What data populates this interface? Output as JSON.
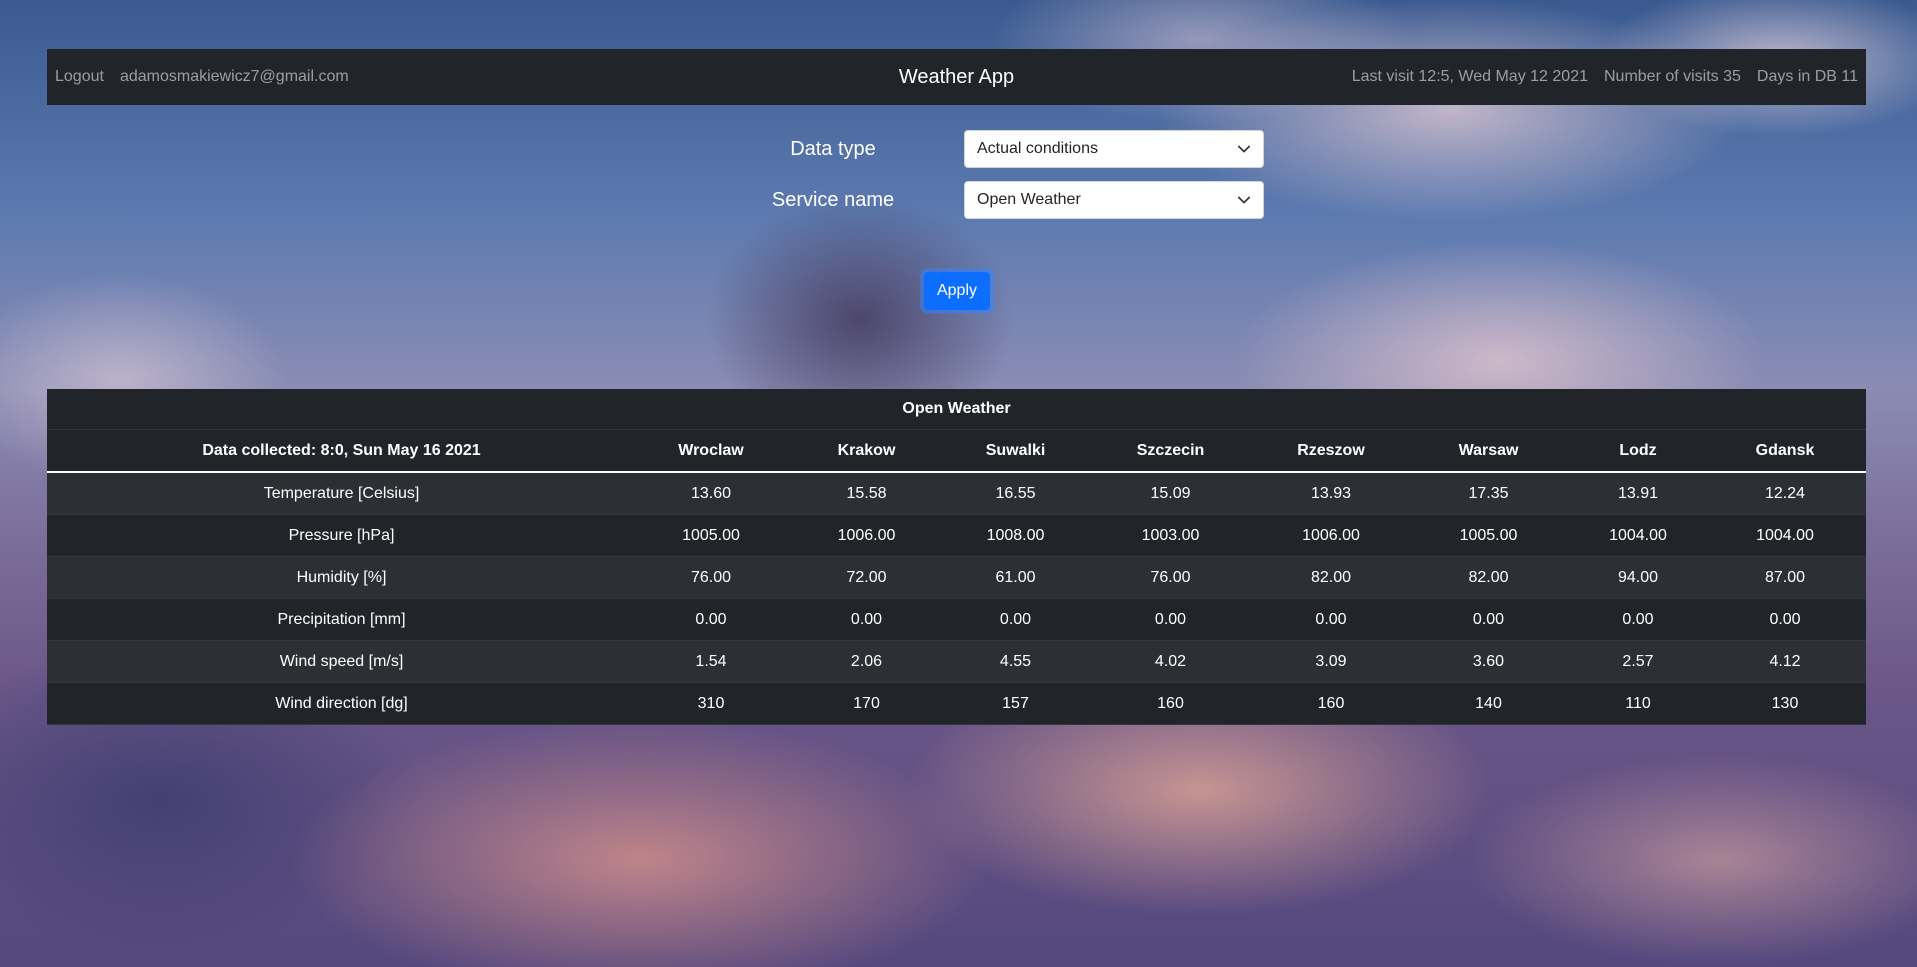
{
  "navbar": {
    "logout_label": "Logout",
    "user_email": "adamosmakiewicz7@gmail.com",
    "brand": "Weather App",
    "last_visit": "Last visit 12:5, Wed May 12 2021",
    "visits": "Number of visits 35",
    "days_in_db": "Days in DB 11"
  },
  "form": {
    "data_type_label": "Data type",
    "data_type_value": "Actual conditions",
    "service_name_label": "Service name",
    "service_name_value": "Open Weather",
    "apply_label": "Apply"
  },
  "table": {
    "caption": "Open Weather",
    "collected_header": "Data collected: 8:0, Sun May 16 2021",
    "cities": [
      "Wroclaw",
      "Krakow",
      "Suwalki",
      "Szczecin",
      "Rzeszow",
      "Warsaw",
      "Lodz",
      "Gdansk"
    ],
    "rows": [
      {
        "label": "Temperature [Celsius]",
        "values": [
          "13.60",
          "15.58",
          "16.55",
          "15.09",
          "13.93",
          "17.35",
          "13.91",
          "12.24"
        ]
      },
      {
        "label": "Pressure [hPa]",
        "values": [
          "1005.00",
          "1006.00",
          "1008.00",
          "1003.00",
          "1006.00",
          "1005.00",
          "1004.00",
          "1004.00"
        ]
      },
      {
        "label": "Humidity [%]",
        "values": [
          "76.00",
          "72.00",
          "61.00",
          "76.00",
          "82.00",
          "82.00",
          "94.00",
          "87.00"
        ]
      },
      {
        "label": "Precipitation [mm]",
        "values": [
          "0.00",
          "0.00",
          "0.00",
          "0.00",
          "0.00",
          "0.00",
          "0.00",
          "0.00"
        ]
      },
      {
        "label": "Wind speed [m/s]",
        "values": [
          "1.54",
          "2.06",
          "4.55",
          "4.02",
          "3.09",
          "3.60",
          "2.57",
          "4.12"
        ]
      },
      {
        "label": "Wind direction [dg]",
        "values": [
          "310",
          "170",
          "157",
          "160",
          "160",
          "140",
          "110",
          "130"
        ]
      }
    ]
  },
  "colors": {
    "navbar_bg": "#212529",
    "primary": "#0d6efd",
    "table_stripe": "#2c3034"
  },
  "icons": {
    "select_arrow": "chevron-down-icon"
  }
}
